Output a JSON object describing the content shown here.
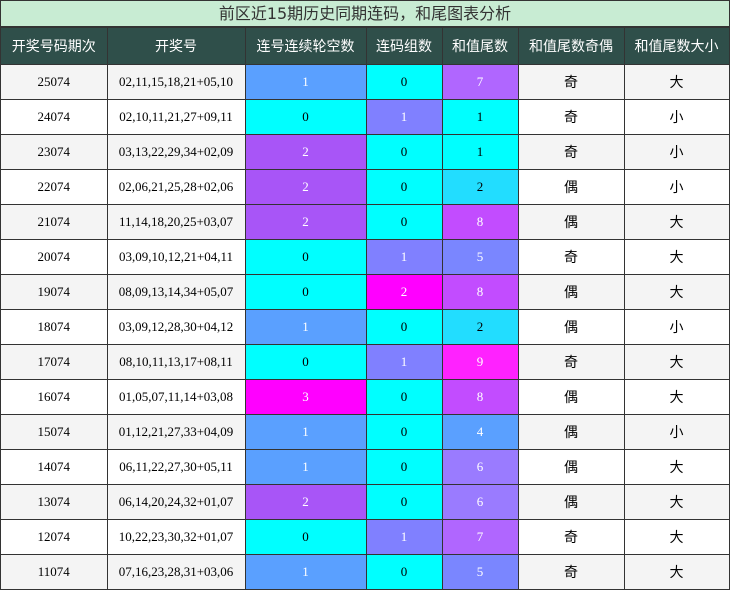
{
  "title": "前区近15期历史同期连码，和尾图表分析",
  "headers": [
    "开奖号码期次",
    "开奖号",
    "连号连续轮空数",
    "连码组数",
    "和值尾数",
    "和值尾数奇偶",
    "和值尾数大小"
  ],
  "colors": {
    "0": "#00ffff",
    "1": "#5aa0ff",
    "2": "#a855f7",
    "3": "#ff00ff",
    "4": "#5aa0ff",
    "5": "#7a86ff",
    "6": "#9a7bff",
    "7": "#b066ff",
    "8": "#c24cff",
    "9": "#ff22ff",
    "rl_0": "#00ffff",
    "rl_1": "#5aa0ff",
    "rl_2": "#a855f7",
    "rl_3": "#ff00ff",
    "lm_0": "#00ffff",
    "lm_1": "#8080ff",
    "lm_2": "#ff00ff",
    "hw_1": "#00ffff",
    "hw_2": "#22ddff",
    "hw_4": "#5aa0ff",
    "hw_5": "#7a86ff",
    "hw_6": "#9a7bff",
    "hw_7": "#b066ff",
    "hw_8": "#c24cff",
    "hw_9": "#ff22ff"
  },
  "rows": [
    {
      "period": "25074",
      "nums": "02,11,15,18,21+05,10",
      "rungap": "1",
      "lianma": "0",
      "hewei": "7",
      "parity": "奇",
      "size": "大"
    },
    {
      "period": "24074",
      "nums": "02,10,11,21,27+09,11",
      "rungap": "0",
      "lianma": "1",
      "hewei": "1",
      "parity": "奇",
      "size": "小"
    },
    {
      "period": "23074",
      "nums": "03,13,22,29,34+02,09",
      "rungap": "2",
      "lianma": "0",
      "hewei": "1",
      "parity": "奇",
      "size": "小"
    },
    {
      "period": "22074",
      "nums": "02,06,21,25,28+02,06",
      "rungap": "2",
      "lianma": "0",
      "hewei": "2",
      "parity": "偶",
      "size": "小"
    },
    {
      "period": "21074",
      "nums": "11,14,18,20,25+03,07",
      "rungap": "2",
      "lianma": "0",
      "hewei": "8",
      "parity": "偶",
      "size": "大"
    },
    {
      "period": "20074",
      "nums": "03,09,10,12,21+04,11",
      "rungap": "0",
      "lianma": "1",
      "hewei": "5",
      "parity": "奇",
      "size": "大"
    },
    {
      "period": "19074",
      "nums": "08,09,13,14,34+05,07",
      "rungap": "0",
      "lianma": "2",
      "hewei": "8",
      "parity": "偶",
      "size": "大"
    },
    {
      "period": "18074",
      "nums": "03,09,12,28,30+04,12",
      "rungap": "1",
      "lianma": "0",
      "hewei": "2",
      "parity": "偶",
      "size": "小"
    },
    {
      "period": "17074",
      "nums": "08,10,11,13,17+08,11",
      "rungap": "0",
      "lianma": "1",
      "hewei": "9",
      "parity": "奇",
      "size": "大"
    },
    {
      "period": "16074",
      "nums": "01,05,07,11,14+03,08",
      "rungap": "3",
      "lianma": "0",
      "hewei": "8",
      "parity": "偶",
      "size": "大"
    },
    {
      "period": "15074",
      "nums": "01,12,21,27,33+04,09",
      "rungap": "1",
      "lianma": "0",
      "hewei": "4",
      "parity": "偶",
      "size": "小"
    },
    {
      "period": "14074",
      "nums": "06,11,22,27,30+05,11",
      "rungap": "1",
      "lianma": "0",
      "hewei": "6",
      "parity": "偶",
      "size": "大"
    },
    {
      "period": "13074",
      "nums": "06,14,20,24,32+01,07",
      "rungap": "2",
      "lianma": "0",
      "hewei": "6",
      "parity": "偶",
      "size": "大"
    },
    {
      "period": "12074",
      "nums": "10,22,23,30,32+01,07",
      "rungap": "0",
      "lianma": "1",
      "hewei": "7",
      "parity": "奇",
      "size": "大"
    },
    {
      "period": "11074",
      "nums": "07,16,23,28,31+03,06",
      "rungap": "1",
      "lianma": "0",
      "hewei": "5",
      "parity": "奇",
      "size": "大"
    }
  ]
}
